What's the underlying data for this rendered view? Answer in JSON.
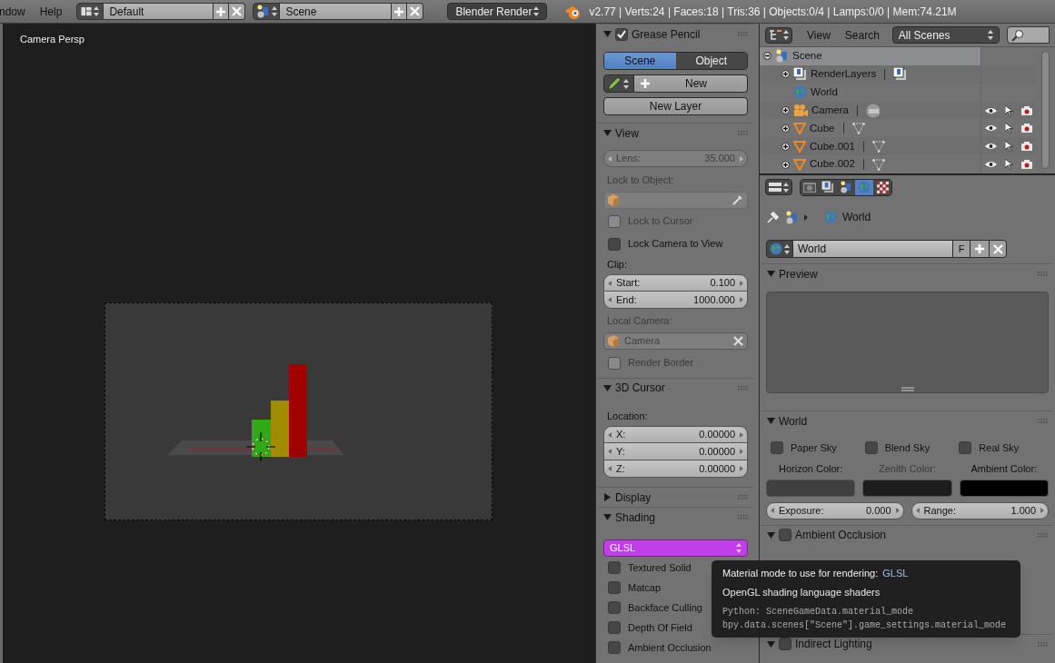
{
  "top_bar": {
    "menus": [
      "ndow",
      "Help"
    ],
    "layout": "Default",
    "scene": "Scene",
    "engine": "Blender Render",
    "stats": "v2.77 | Verts:24 | Faces:18 | Tris:36 | Objects:0/4 | Lamps:0/0 | Mem:74.21M"
  },
  "viewport": {
    "label": "Camera Persp"
  },
  "tool_panel": {
    "grease_pencil": {
      "title": "Grease Pencil",
      "enabled": true,
      "expanded": true,
      "tabs": [
        {
          "label": "Scene",
          "selected": true
        },
        {
          "label": "Object",
          "selected": false
        }
      ],
      "new_button": "New",
      "new_layer_button": "New Layer"
    },
    "view": {
      "title": "View",
      "expanded": true,
      "lens": {
        "label": "Lens:",
        "value": "35.000",
        "disabled": true
      },
      "lock_to_object_label": {
        "text": "Lock to Object:",
        "disabled": true
      },
      "lock_to_cursor": {
        "label": "Lock to Cursor",
        "checked": false,
        "disabled": true
      },
      "lock_camera_to_view": {
        "label": "Lock Camera to View",
        "checked": false,
        "disabled": false
      },
      "clip_label": "Clip:",
      "clip": [
        {
          "label": "Start:",
          "value": "0.100"
        },
        {
          "label": "End:",
          "value": "1000.000"
        }
      ],
      "local_camera_label": {
        "text": "Local Camera:",
        "disabled": true
      },
      "local_camera": {
        "value": "Camera",
        "disabled": true
      },
      "render_border": {
        "label": "Render Border",
        "checked": false,
        "disabled": true
      }
    },
    "cursor": {
      "title": "3D Cursor",
      "expanded": true,
      "location_label": "Location:",
      "location": [
        {
          "label": "X:",
          "value": "0.00000"
        },
        {
          "label": "Y:",
          "value": "0.00000"
        },
        {
          "label": "Z:",
          "value": "0.00000"
        }
      ]
    },
    "display": {
      "title": "Display",
      "expanded": false
    },
    "shading": {
      "title": "Shading",
      "expanded": true,
      "material_mode": "GLSL",
      "options": [
        {
          "label": "Textured Solid",
          "checked": false
        },
        {
          "label": "Matcap",
          "checked": false
        },
        {
          "label": "Backface Culling",
          "checked": false
        },
        {
          "label": "Depth Of Field",
          "checked": false
        },
        {
          "label": "Ambient Occlusion",
          "checked": false
        }
      ]
    }
  },
  "outliner": {
    "menus": [
      "View",
      "Search"
    ],
    "filter": "All Scenes",
    "tree": [
      {
        "name": "Scene",
        "kind": "scene",
        "expanded": true,
        "selected": true,
        "children": [
          {
            "name": "RenderLayers",
            "kind": "render_layers",
            "expanded": false,
            "selected": false
          },
          {
            "name": "World",
            "kind": "world",
            "selected": false
          },
          {
            "name": "Camera",
            "kind": "camera",
            "expanded": false,
            "selected": false
          },
          {
            "name": "Cube",
            "kind": "mesh",
            "expanded": false,
            "selected": false
          },
          {
            "name": "Cube.001",
            "kind": "mesh",
            "expanded": false,
            "selected": false
          },
          {
            "name": "Cube.002",
            "kind": "mesh",
            "expanded": false,
            "selected": false
          }
        ]
      }
    ]
  },
  "properties": {
    "context_tabs": [
      {
        "kind": "render",
        "selected": false
      },
      {
        "kind": "render_layers",
        "selected": false
      },
      {
        "kind": "scene",
        "selected": false
      },
      {
        "kind": "world",
        "selected": true
      },
      {
        "kind": "texture",
        "selected": false
      }
    ],
    "breadcrumb": "World",
    "world_block": {
      "name": "World",
      "fake_user": "F"
    },
    "preview": {
      "title": "Preview",
      "expanded": true
    },
    "world": {
      "title": "World",
      "expanded": true,
      "skies": [
        {
          "label": "Paper Sky",
          "checked": false
        },
        {
          "label": "Blend Sky",
          "checked": false
        },
        {
          "label": "Real Sky",
          "checked": false
        }
      ],
      "colors": [
        {
          "label": "Horizon Color:",
          "color": "#3f3f3f",
          "disabled": false
        },
        {
          "label": "Zenith Color:",
          "color": "#1d1d1d",
          "disabled": true
        },
        {
          "label": "Ambient Color:",
          "color": "#000000",
          "disabled": false
        }
      ],
      "exposure": {
        "label": "Exposure:",
        "value": "0.000"
      },
      "range": {
        "label": "Range:",
        "value": "1.000"
      }
    },
    "ambient_occlusion": {
      "title": "Ambient Occlusion",
      "enabled": false,
      "expanded": true
    },
    "indirect_lighting": {
      "title": "Indirect Lighting",
      "enabled": false,
      "expanded": true
    }
  },
  "tooltip": {
    "title": "Material mode to use for rendering:",
    "value": "GLSL",
    "description": "OpenGL shading language shaders",
    "python": [
      "Python: SceneGameData.material_mode",
      "bpy.data.scenes[\"Scene\"].game_settings.material_mode"
    ]
  }
}
